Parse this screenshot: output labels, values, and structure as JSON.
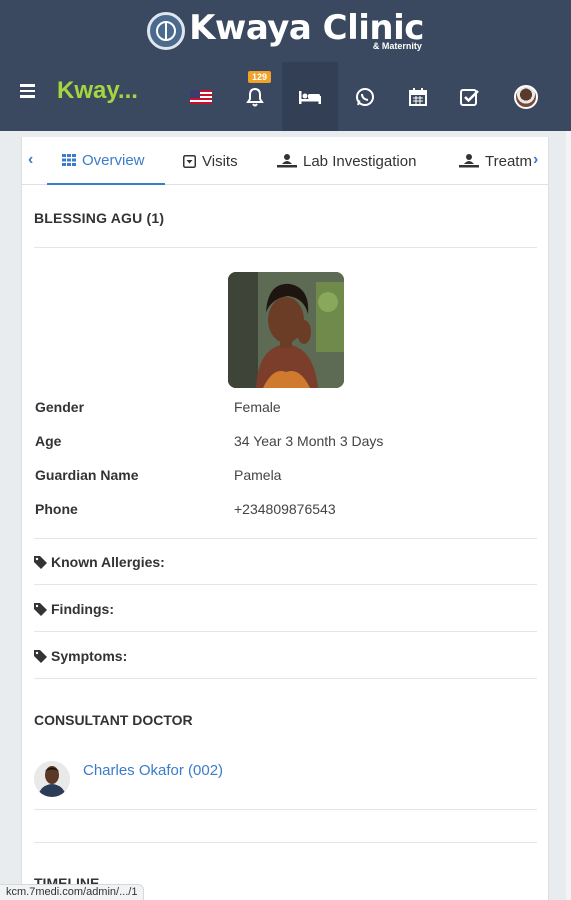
{
  "header": {
    "logo_title": "Kwaya Clinic",
    "logo_subtitle": "& Maternity",
    "brand": "Kway...",
    "notification_count": "129",
    "colors": {
      "bar": "#3b4960",
      "brand": "#a6d63f",
      "badge": "#f0a32b"
    },
    "icons": [
      "hamburger-icon",
      "us-flag-icon",
      "bell-icon",
      "bed-icon",
      "whatsapp-icon",
      "calendar-icon",
      "check-square-icon",
      "user-avatar"
    ]
  },
  "tabs": {
    "items": [
      {
        "label": "Overview",
        "icon": "grid-icon"
      },
      {
        "label": "Visits",
        "icon": "caret-square-icon"
      },
      {
        "label": "Lab Investigation",
        "icon": "microscope-icon"
      },
      {
        "label": "Treatm",
        "icon": "bed-icon"
      }
    ],
    "active": "Overview"
  },
  "patient": {
    "name": "BLESSING AGU (1)",
    "fields": [
      {
        "label": "Gender",
        "value": "Female"
      },
      {
        "label": "Age",
        "value": "34 Year 3 Month 3 Days"
      },
      {
        "label": "Guardian Name",
        "value": "Pamela"
      },
      {
        "label": "Phone",
        "value": "+234809876543"
      }
    ]
  },
  "sections": [
    {
      "label": "Known Allergies:",
      "icon": "tag-icon"
    },
    {
      "label": "Findings:",
      "icon": "tag-icon"
    },
    {
      "label": "Symptoms:",
      "icon": "tag-icon"
    }
  ],
  "consultant": {
    "title": "CONSULTANT DOCTOR",
    "doctor_name": "Charles Okafor (002)"
  },
  "timeline": {
    "title": "TIMELINE"
  },
  "status_url": "kcm.7medi.com/admin/.../1"
}
